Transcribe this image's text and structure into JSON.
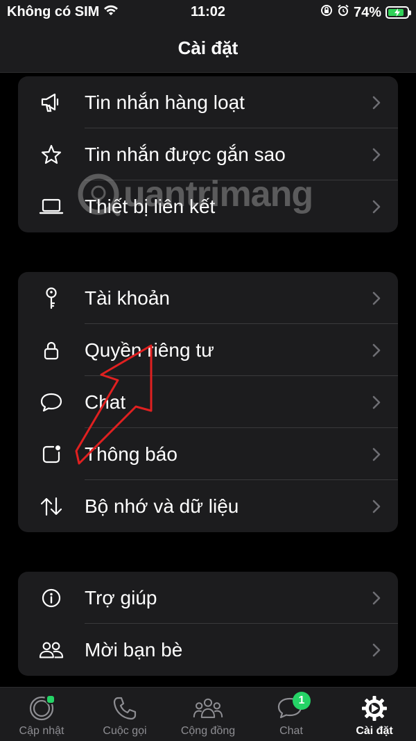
{
  "status_bar": {
    "carrier": "Không có SIM",
    "time": "11:02",
    "battery": "74%"
  },
  "header": {
    "title": "Cài đặt"
  },
  "groups": [
    {
      "items": [
        {
          "label": "Tin nhắn hàng loạt",
          "icon": "megaphone-icon"
        },
        {
          "label": "Tin nhắn được gắn sao",
          "icon": "star-icon"
        },
        {
          "label": "Thiết bị liên kết",
          "icon": "laptop-icon"
        }
      ]
    },
    {
      "items": [
        {
          "label": "Tài khoản",
          "icon": "key-icon"
        },
        {
          "label": "Quyền riêng tư",
          "icon": "lock-icon"
        },
        {
          "label": "Chat",
          "icon": "chat-bubble-icon"
        },
        {
          "label": "Thông báo",
          "icon": "notification-icon"
        },
        {
          "label": "Bộ nhớ và dữ liệu",
          "icon": "data-arrows-icon"
        }
      ]
    },
    {
      "items": [
        {
          "label": "Trợ giúp",
          "icon": "info-icon"
        },
        {
          "label": "Mời bạn bè",
          "icon": "people-icon"
        }
      ]
    }
  ],
  "tabs": [
    {
      "label": "Cập nhật",
      "icon": "updates-icon"
    },
    {
      "label": "Cuộc gọi",
      "icon": "phone-icon"
    },
    {
      "label": "Cộng đồng",
      "icon": "community-icon"
    },
    {
      "label": "Chat",
      "icon": "chats-icon",
      "badge": "1"
    },
    {
      "label": "Cài đặt",
      "icon": "settings-gear-icon",
      "active": true
    }
  ],
  "watermark": {
    "text": "uantrimang"
  },
  "colors": {
    "background": "#000000",
    "surface": "#1c1c1e",
    "separator": "#3a3a3c",
    "accent_green": "#25d366",
    "annotation_red": "#e02020"
  }
}
